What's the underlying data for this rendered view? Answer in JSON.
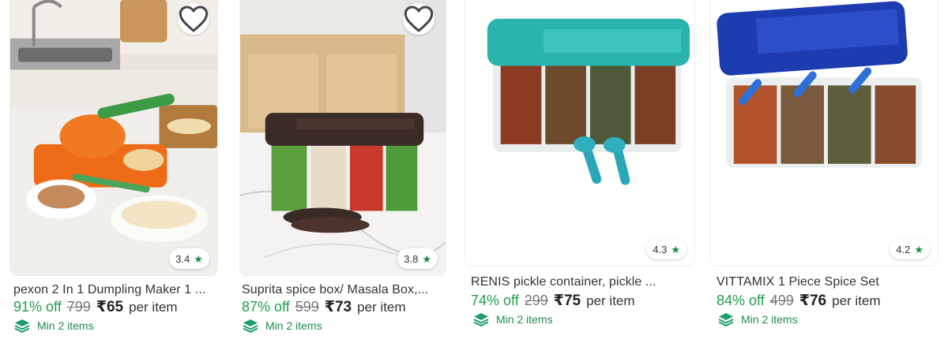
{
  "products": [
    {
      "title": "pexon 2 In 1 Dumpling Maker 1 ...",
      "rating": "3.4",
      "discount": "91% off",
      "mrp": "799",
      "price": "₹65",
      "per_item": "per item",
      "min_qty": "Min 2 items",
      "favorite_icon": "heart-outline-icon",
      "rating_icon": "star-icon",
      "min_icon": "layers-icon"
    },
    {
      "title": "Suprita spice box/ Masala Box,...",
      "rating": "3.8",
      "discount": "87% off",
      "mrp": "599",
      "price": "₹73",
      "per_item": "per item",
      "min_qty": "Min 2 items",
      "favorite_icon": "heart-outline-icon",
      "rating_icon": "star-icon",
      "min_icon": "layers-icon"
    },
    {
      "title": "RENIS pickle container, pickle ...",
      "rating": "4.3",
      "discount": "74% off",
      "mrp": "299",
      "price": "₹75",
      "per_item": "per item",
      "min_qty": "Min 2 items",
      "favorite_icon": "heart-outline-icon",
      "rating_icon": "star-icon",
      "min_icon": "layers-icon"
    },
    {
      "title": "VITTAMIX 1 Piece Spice Set",
      "rating": "4.2",
      "discount": "84% off",
      "mrp": "499",
      "price": "₹76",
      "per_item": "per item",
      "min_qty": "Min 2 items",
      "favorite_icon": "heart-outline-icon",
      "rating_icon": "star-icon",
      "min_icon": "layers-icon"
    }
  ],
  "colors": {
    "discount_green": "#1f9d4a",
    "rating_star_green": "#1f8a3a",
    "min_text_green": "#1f8a4a"
  }
}
